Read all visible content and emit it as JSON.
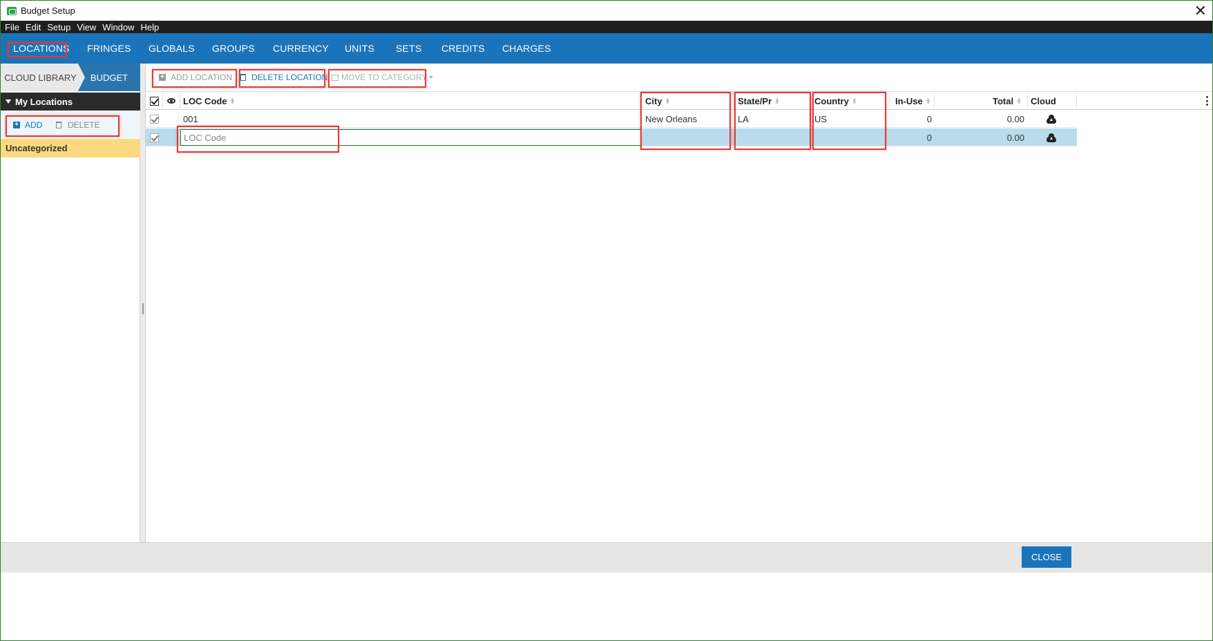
{
  "window": {
    "title": "Budget Setup",
    "close_glyph": "✕"
  },
  "menu": [
    "File",
    "Edit",
    "Setup",
    "View",
    "Window",
    "Help"
  ],
  "tabs": [
    "LOCATIONS",
    "FRINGES",
    "GLOBALS",
    "GROUPS",
    "CURRENCY",
    "UNITS",
    "SETS",
    "CREDITS",
    "CHARGES"
  ],
  "active_tab": "LOCATIONS",
  "library": {
    "cloud_label": "CLOUD LIBRARY",
    "budget_label": "BUDGET"
  },
  "left": {
    "section_title": "My Locations",
    "add_label": "ADD",
    "delete_label": "DELETE",
    "category": "Uncategorized"
  },
  "toolbar": {
    "add_location": "ADD LOCATION",
    "delete_location": "DELETE LOCATION",
    "move_to_category": "MOVE TO CATEGORY"
  },
  "grid": {
    "columns": {
      "loc_code": "LOC Code",
      "city": "City",
      "state": "State/Pr",
      "country": "Country",
      "in_use": "In-Use",
      "total": "Total",
      "cloud": "Cloud"
    },
    "rows": [
      {
        "loc_code": "001",
        "city": "New Orleans",
        "state": "LA",
        "country": "US",
        "in_use": "0",
        "total": "0.00"
      },
      {
        "loc_code": "",
        "loc_code_placeholder": "LOC Code",
        "city": "",
        "state": "",
        "country": "",
        "in_use": "0",
        "total": "0.00"
      }
    ]
  },
  "footer": {
    "close_label": "CLOSE"
  },
  "colors": {
    "accent": "#1b74b9",
    "category_bg": "#fbd97e",
    "selected_row": "#b9dcec",
    "annotation": "#e53935"
  }
}
